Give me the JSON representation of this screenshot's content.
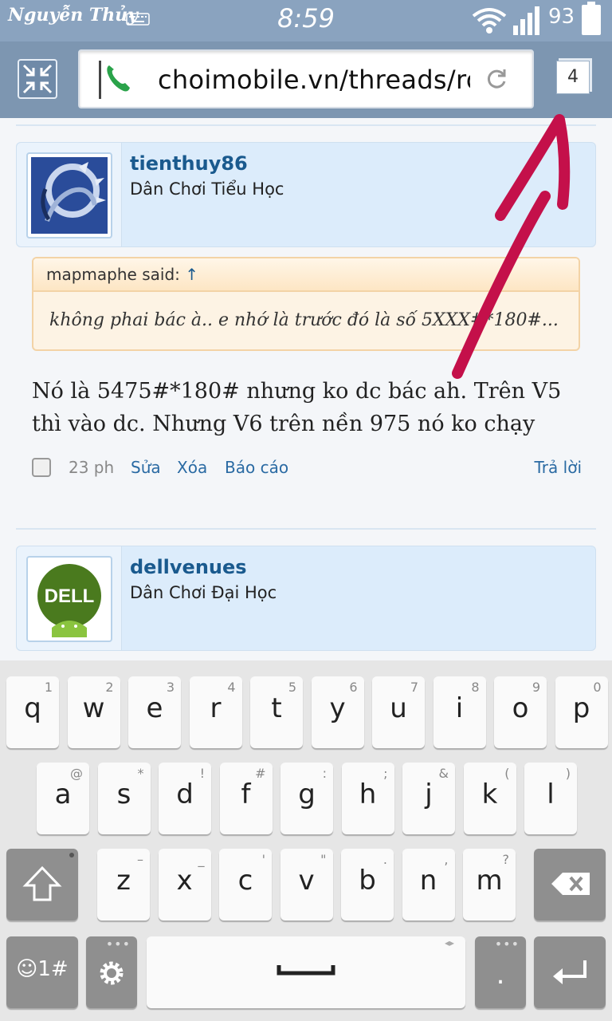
{
  "status_bar": {
    "carrier": "Nguyễn Thủy",
    "time": "8:59",
    "battery": "93"
  },
  "browser": {
    "url": "choimobile.vn/threads/rom",
    "tab_count": "4"
  },
  "posts": [
    {
      "username": "tienthuy86",
      "user_title": "Dân Chơi Tiểu Học",
      "quote_author": "mapmaphe said:",
      "quote_arrow": "↑",
      "quote_text": "không phai bác à.. e nhớ là trước đó là số 5XXX#*180#...",
      "message": "Nó là 5475#*180# nhưng ko dc bác ah. Trên V5 thì vào dc. Nhưng V6 trên nền 975 nó ko chạy",
      "time": "23 ph",
      "actions": {
        "edit": "Sửa",
        "delete": "Xóa",
        "report": "Báo cáo",
        "reply": "Trả lời"
      }
    },
    {
      "username": "dellvenues",
      "user_title": "Dân Chơi Đại Học"
    }
  ],
  "keyboard": {
    "row1": [
      {
        "k": "q",
        "s": "1"
      },
      {
        "k": "w",
        "s": "2"
      },
      {
        "k": "e",
        "s": "3"
      },
      {
        "k": "r",
        "s": "4"
      },
      {
        "k": "t",
        "s": "5"
      },
      {
        "k": "y",
        "s": "6"
      },
      {
        "k": "u",
        "s": "7"
      },
      {
        "k": "i",
        "s": "8"
      },
      {
        "k": "o",
        "s": "9"
      },
      {
        "k": "p",
        "s": "0"
      }
    ],
    "row2": [
      {
        "k": "a",
        "s": "@"
      },
      {
        "k": "s",
        "s": "*"
      },
      {
        "k": "d",
        "s": "!"
      },
      {
        "k": "f",
        "s": "#"
      },
      {
        "k": "g",
        "s": ":"
      },
      {
        "k": "h",
        "s": ";"
      },
      {
        "k": "j",
        "s": "&"
      },
      {
        "k": "k",
        "s": "("
      },
      {
        "k": "l",
        "s": ")"
      }
    ],
    "row3": [
      {
        "k": "z",
        "s": "–"
      },
      {
        "k": "x",
        "s": "_"
      },
      {
        "k": "c",
        "s": "'"
      },
      {
        "k": "v",
        "s": "\""
      },
      {
        "k": "b",
        "s": "."
      },
      {
        "k": "n",
        "s": ","
      },
      {
        "k": "m",
        "s": "?"
      }
    ],
    "mode_label": "☺1#",
    "period": "."
  },
  "colors": {
    "status_bar": "#8aa3bf",
    "toolbar": "#7d96b1",
    "link": "#2a6aa3",
    "annotation_arrow": "#c4104a"
  }
}
